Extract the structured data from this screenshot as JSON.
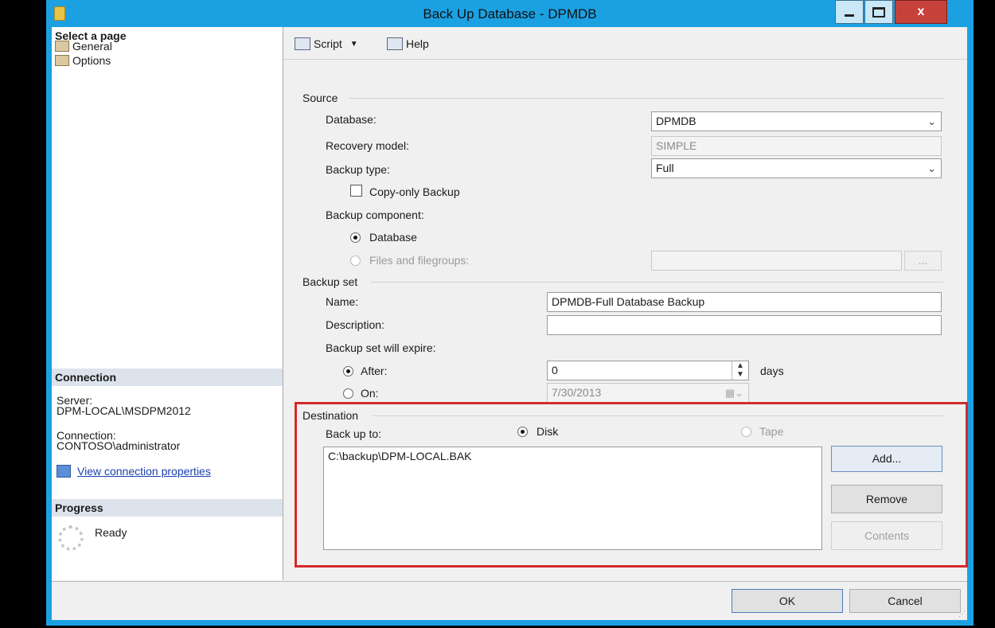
{
  "window": {
    "title": "Back Up Database - DPMDB",
    "close_label": "x"
  },
  "left": {
    "select_page_header": "Select a page",
    "pages": [
      {
        "label": "General"
      },
      {
        "label": "Options"
      }
    ],
    "connection_header": "Connection",
    "server_label": "Server:",
    "server_value": "DPM-LOCAL\\MSDPM2012",
    "connection_label": "Connection:",
    "connection_value": "CONTOSO\\administrator",
    "view_connection_link": "View connection properties",
    "progress_header": "Progress",
    "progress_status": "Ready"
  },
  "toolbar": {
    "script_label": "Script",
    "help_label": "Help"
  },
  "source": {
    "header": "Source",
    "database_label": "Database:",
    "database_value": "DPMDB",
    "recovery_label": "Recovery model:",
    "recovery_value": "SIMPLE",
    "backup_type_label": "Backup type:",
    "backup_type_value": "Full",
    "copy_only_label": "Copy-only Backup",
    "component_label": "Backup component:",
    "component_database": "Database",
    "component_files": "Files and filegroups:",
    "files_browse": "..."
  },
  "backup_set": {
    "header": "Backup set",
    "name_label": "Name:",
    "name_value": "DPMDB-Full Database Backup",
    "description_label": "Description:",
    "description_value": "",
    "expire_label": "Backup set will expire:",
    "after_label": "After:",
    "after_value": "0",
    "days_label": "days",
    "on_label": "On:",
    "on_value": "7/30/2013"
  },
  "destination": {
    "header": "Destination",
    "backup_to_label": "Back up to:",
    "disk_label": "Disk",
    "tape_label": "Tape",
    "paths": [
      "C:\\backup\\DPM-LOCAL.BAK"
    ],
    "add_label": "Add...",
    "remove_label": "Remove",
    "contents_label": "Contents"
  },
  "footer": {
    "ok_label": "OK",
    "cancel_label": "Cancel"
  },
  "colors": {
    "window_frame": "#1ba1e2",
    "highlight_border": "#d42a2a",
    "close_button": "#c7413b"
  }
}
